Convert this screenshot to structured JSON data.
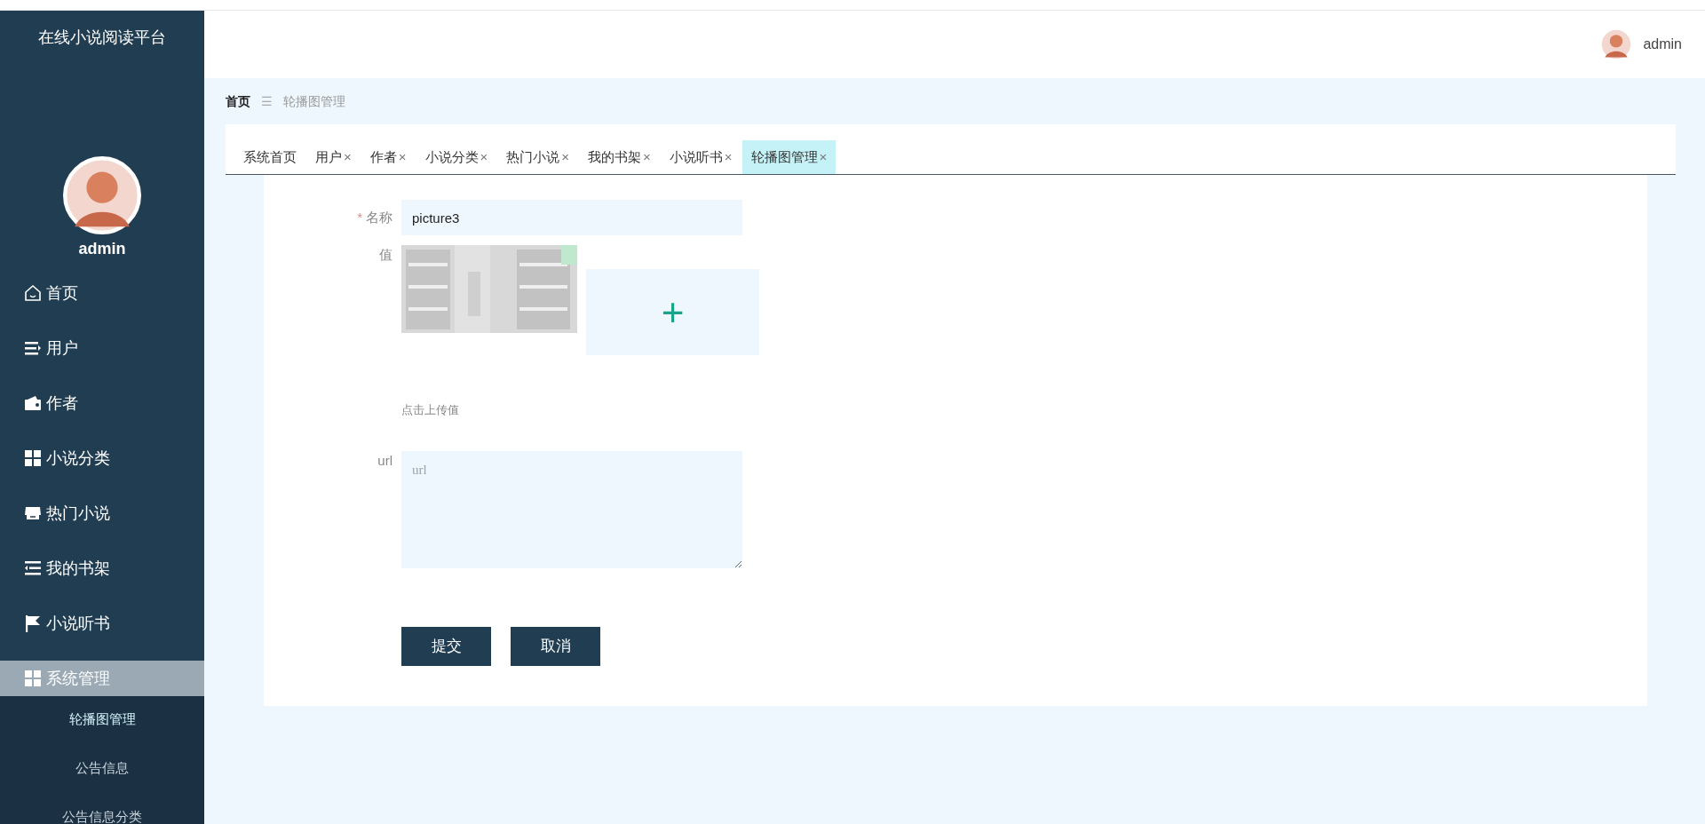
{
  "app_title": "在线小说阅读平台",
  "user": {
    "name": "admin"
  },
  "sidebar": {
    "items": [
      {
        "label": "首页",
        "kind": "home",
        "selected": false
      },
      {
        "label": "用户",
        "kind": "list",
        "selected": false
      },
      {
        "label": "作者",
        "kind": "wallet",
        "selected": false
      },
      {
        "label": "小说分类",
        "kind": "grid",
        "selected": false
      },
      {
        "label": "热门小说",
        "kind": "shop",
        "selected": false
      },
      {
        "label": "我的书架",
        "kind": "indent",
        "selected": false
      },
      {
        "label": "小说听书",
        "kind": "flag",
        "selected": false
      },
      {
        "label": "系统管理",
        "kind": "grid",
        "selected": true,
        "expanded": true,
        "children": [
          {
            "label": "轮播图管理",
            "selected": true
          },
          {
            "label": "公告信息",
            "selected": false
          },
          {
            "label": "公告信息分类",
            "selected": false
          }
        ]
      }
    ]
  },
  "header": {
    "user_name": "admin"
  },
  "breadcrumb": [
    "首页",
    "轮播图管理"
  ],
  "breadcrumb_separator": "☰",
  "tabs": [
    {
      "label": "系统首页",
      "closable": false,
      "selected": false
    },
    {
      "label": "用户",
      "closable": true,
      "selected": false
    },
    {
      "label": "作者",
      "closable": true,
      "selected": false
    },
    {
      "label": "小说分类",
      "closable": true,
      "selected": false
    },
    {
      "label": "热门小说",
      "closable": true,
      "selected": false
    },
    {
      "label": "我的书架",
      "closable": true,
      "selected": false
    },
    {
      "label": "小说听书",
      "closable": true,
      "selected": false
    },
    {
      "label": "轮播图管理",
      "closable": true,
      "selected": true
    }
  ],
  "tab_close": "×",
  "form": {
    "name": {
      "label": "名称",
      "required": true,
      "required_mark": "*",
      "value": "picture3"
    },
    "value": {
      "label": "值",
      "upload_symbol": "+",
      "hint": "点击上传值"
    },
    "url": {
      "label": "url",
      "placeholder": "url"
    },
    "buttons": [
      "提交",
      "取消"
    ]
  }
}
